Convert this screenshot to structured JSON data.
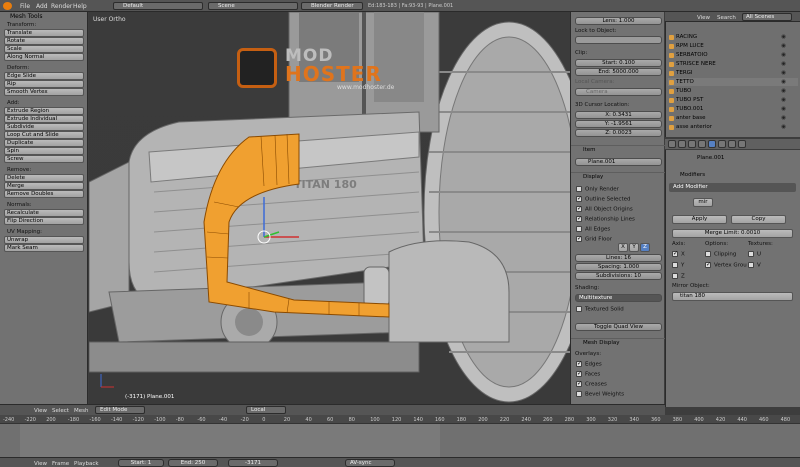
{
  "topbar": {
    "menus": [
      "File",
      "Add",
      "Render",
      "Help"
    ],
    "layout": "Default",
    "scene": "Scene",
    "engine": "Blender Render",
    "stats": "Ed:183-183 | Fa:93-93 | Plane.001"
  },
  "toolshelf": {
    "title": "Mesh Tools",
    "sections": [
      {
        "label": "Transform:",
        "buttons": [
          "Translate",
          "Rotate",
          "Scale",
          "Along Normal"
        ]
      },
      {
        "label": "Deform:",
        "buttons": [
          "Edge Slide",
          "Rip",
          "Smooth Vertex"
        ]
      },
      {
        "label": "Add:",
        "buttons": [
          "Extrude Region",
          "Extrude Individual",
          "Subdivide",
          "Loop Cut and Slide",
          "Duplicate",
          "Spin",
          "Screw"
        ]
      },
      {
        "label": "Remove:",
        "buttons": [
          "Delete",
          "Merge",
          "Remove Doubles"
        ]
      },
      {
        "label": "Normals:",
        "buttons": [
          "Recalculate",
          "Flip Direction"
        ]
      },
      {
        "label": "UV Mapping:",
        "buttons": [
          "Unwrap",
          "Mark Seam"
        ]
      }
    ]
  },
  "viewport": {
    "label": "User Ortho",
    "object_label": "(-3171) Plane.001",
    "logo_top": "MOD",
    "logo_bottom": "HOSTER",
    "logo_url": "www.modhoster.de",
    "hood_text": "TITAN 180"
  },
  "npanel": {
    "lens": "Lens: 1.000",
    "lock_label": "Lock to Object:",
    "clip_label": "Clip:",
    "clip_start": "Start: 0.100",
    "clip_end": "End: 5000.000",
    "local_camera": "Local Camera:",
    "camera": "Camera",
    "cursor_label": "3D Cursor Location:",
    "cursor_x": "X: 0.3431",
    "cursor_y": "Y: -1.9561",
    "cursor_z": "Z: 0.0023",
    "item_label": "Item",
    "item_name": "Plane.001",
    "display_label": "Display",
    "display_checks": [
      {
        "label": "Only Render",
        "checked": false
      },
      {
        "label": "Outline Selected",
        "checked": true
      },
      {
        "label": "All Object Origins",
        "checked": true
      },
      {
        "label": "Relationship Lines",
        "checked": true
      },
      {
        "label": "All Edges",
        "checked": false
      },
      {
        "label": "Grid Floor",
        "checked": true
      }
    ],
    "axes": [
      "X",
      "Y",
      "Z"
    ],
    "lines": "Lines: 16",
    "spacing": "Spacing: 1.000",
    "subdivisions": "Subdivisions: 10",
    "shading_label": "Shading:",
    "shading": "Multitexture",
    "textured_solid": "Textured Solid",
    "toggle_quad": "Toggle Quad View",
    "mesh_display": "Mesh Display",
    "overlays": "Overlays:",
    "overlay_checks": [
      {
        "label": "Edges",
        "checked": true
      },
      {
        "label": "Faces",
        "checked": true
      },
      {
        "label": "Creases",
        "checked": true
      },
      {
        "label": "Bevel Weights",
        "checked": false
      }
    ]
  },
  "outliner": {
    "menu": [
      "View",
      "Search"
    ],
    "scenes": "All Scenes",
    "items": [
      "RACING",
      "RPM LUCE",
      "SERBATOIO",
      "STRISCE NERE",
      "TERGI",
      "TETTO",
      "TUBO",
      "TUBO PST",
      "TUBO.001",
      "anter base",
      "asse anterior"
    ]
  },
  "props": {
    "object_name": "Plane.001",
    "modifiers_label": "Modifiers",
    "add_modifier": "Add Modifier",
    "mod_name": "mir",
    "apply": "Apply",
    "copy": "Copy",
    "merge_limit": "Merge Limit: 0.0010",
    "axis_label": "Axis:",
    "options_label": "Options:",
    "textures_label": "Textures:",
    "axis_x": "X",
    "axis_y": "Y",
    "axis_z": "Z",
    "clipping": "Clipping",
    "vertex_groups": "Vertex Grou",
    "tex_u": "U",
    "tex_v": "V",
    "mirror_object": "Mirror Object:",
    "mirror_target": "titan 180"
  },
  "vp_header": {
    "menus": [
      "View",
      "Select",
      "Mesh"
    ],
    "mode": "Edit Mode",
    "pivot": "Local"
  },
  "timeline": {
    "ticks": [
      "-240",
      "-220",
      "200",
      "-180",
      "-160",
      "-140",
      "-120",
      "-100",
      "-80",
      "-60",
      "-40",
      "-20",
      "0",
      "20",
      "40",
      "60",
      "80",
      "100",
      "120",
      "140",
      "160",
      "180",
      "200",
      "220",
      "240",
      "260",
      "280",
      "300",
      "320",
      "340",
      "360",
      "380",
      "400",
      "420",
      "440",
      "460",
      "480"
    ],
    "menus": [
      "View",
      "Frame",
      "Playback"
    ],
    "start": "Start: 1",
    "end": "End: 250",
    "current": "-3171",
    "sync": "AV-sync"
  },
  "colors": {
    "selection": "#f0a030",
    "accent": "#5680c2"
  }
}
